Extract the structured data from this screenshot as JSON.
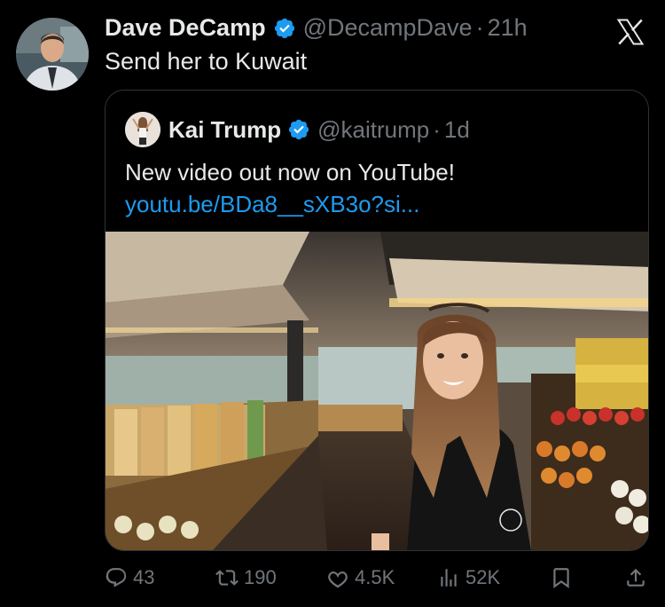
{
  "tweet": {
    "author_name": "Dave DeCamp",
    "author_handle": "@DecampDave",
    "separator": "·",
    "time": "21h",
    "text": "Send her to Kuwait"
  },
  "quoted_tweet": {
    "author_name": "Kai Trump",
    "author_handle": "@kaitrump",
    "separator": "·",
    "time": "1d",
    "text": "New video out now on YouTube!",
    "link": "youtu.be/BDa8__sXB3o?si..."
  },
  "actions": {
    "replies": "43",
    "reposts": "190",
    "likes": "4.5K",
    "views": "52K"
  },
  "icons": {
    "verified": "verified-badge-icon",
    "logo": "x-logo-icon",
    "reply": "reply-icon",
    "repost": "repost-icon",
    "like": "heart-icon",
    "views": "views-icon",
    "bookmark": "bookmark-icon",
    "share": "share-icon"
  },
  "colors": {
    "background": "#000000",
    "text": "#e7e9ea",
    "secondary": "#71767b",
    "link": "#1d9bf0",
    "verified": "#1d9bf0",
    "border": "#2f3336"
  }
}
